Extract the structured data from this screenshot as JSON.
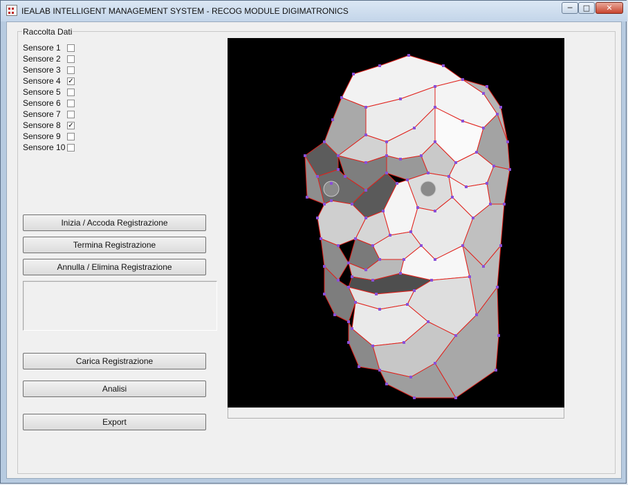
{
  "window": {
    "title": "IEALAB INTELLIGENT MANAGEMENT SYSTEM - RECOG MODULE DIGIMATRONICS",
    "behind_title": "...",
    "controls": {
      "minimize": "─",
      "maximize": "□",
      "close": "✕"
    }
  },
  "group": {
    "title": "Raccolta Dati"
  },
  "sensors": [
    {
      "label": "Sensore 1",
      "checked": false
    },
    {
      "label": "Sensore 2",
      "checked": false
    },
    {
      "label": "Sensore 3",
      "checked": false
    },
    {
      "label": "Sensore 4",
      "checked": true
    },
    {
      "label": "Sensore 5",
      "checked": false
    },
    {
      "label": "Sensore 6",
      "checked": false
    },
    {
      "label": "Sensore 7",
      "checked": false
    },
    {
      "label": "Sensore 8",
      "checked": true
    },
    {
      "label": "Sensore 9",
      "checked": false
    },
    {
      "label": "Sensore 10",
      "checked": false
    }
  ],
  "buttons": {
    "start": "Inizia / Accoda Registrazione",
    "stop": "Termina Registrazione",
    "cancel": "Annulla / Elimina Registrazione",
    "load": "Carica Registrazione",
    "analyze": "Analisi",
    "export": "Export"
  },
  "log_text": "",
  "viewport": {
    "background": "#000000",
    "mesh_fill": "#d8d8d8",
    "edge_color": "#e0201a",
    "vertex_color": "#8a4fd8"
  },
  "status_text": ""
}
